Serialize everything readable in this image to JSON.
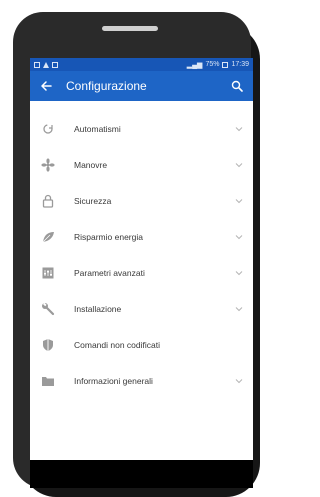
{
  "status_bar": {
    "signal_text": "Wifi 4G",
    "battery": "75%",
    "time": "17:39"
  },
  "app_bar": {
    "title": "Configurazione"
  },
  "menu": {
    "items": [
      {
        "label": "Automatismi",
        "icon": "automation-icon",
        "has_chevron": true
      },
      {
        "label": "Manovre",
        "icon": "fan-icon",
        "has_chevron": true
      },
      {
        "label": "Sicurezza",
        "icon": "lock-icon",
        "has_chevron": true
      },
      {
        "label": "Risparmio energia",
        "icon": "leaf-icon",
        "has_chevron": true
      },
      {
        "label": "Parametri avanzati",
        "icon": "sliders-icon",
        "has_chevron": true
      },
      {
        "label": "Installazione",
        "icon": "wrench-icon",
        "has_chevron": true
      },
      {
        "label": "Comandi non codificati",
        "icon": "shield-icon",
        "has_chevron": false
      },
      {
        "label": "Informazioni generali",
        "icon": "folder-icon",
        "has_chevron": true
      }
    ]
  },
  "colors": {
    "status_bar": "#1756b6",
    "app_bar": "#1e65c6",
    "icon": "#9a9a9a"
  }
}
